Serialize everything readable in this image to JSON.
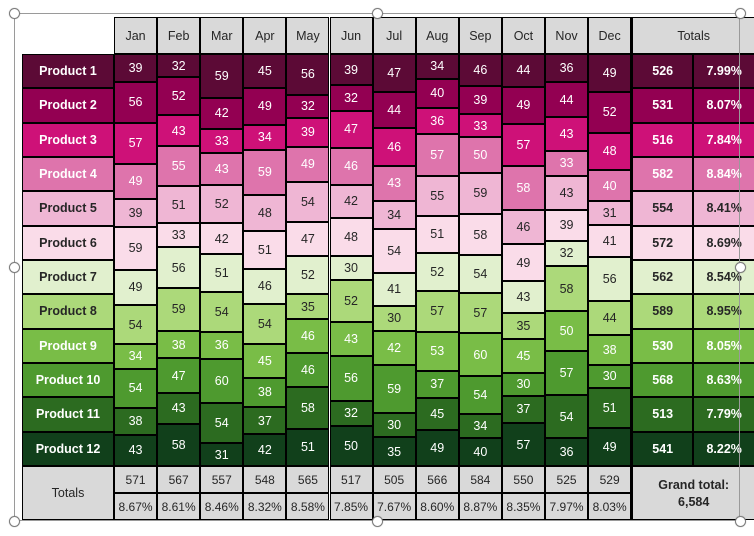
{
  "chart_data": {
    "type": "heatmap",
    "title": "",
    "xlabel": "",
    "ylabel": "",
    "grid": true,
    "legend": "none",
    "note": "Proportional-height heat map matrix: cell height within each month column is proportional to its value; row color encodes product rank (magenta-to-green diverging scale).",
    "categories": [
      "Jan",
      "Feb",
      "Mar",
      "Apr",
      "May",
      "Jun",
      "Jul",
      "Aug",
      "Sep",
      "Oct",
      "Nov",
      "Dec"
    ],
    "row_labels": [
      "Product 1",
      "Product 2",
      "Product 3",
      "Product 4",
      "Product 5",
      "Product 6",
      "Product 7",
      "Product 8",
      "Product 9",
      "Product 10",
      "Product 11",
      "Product 12"
    ],
    "series": [
      {
        "name": "Product 1",
        "values": [
          39,
          32,
          59,
          45,
          56,
          39,
          47,
          34,
          46,
          44,
          36,
          49
        ]
      },
      {
        "name": "Product 2",
        "values": [
          56,
          52,
          42,
          49,
          32,
          32,
          44,
          40,
          39,
          49,
          44,
          52
        ]
      },
      {
        "name": "Product 3",
        "values": [
          57,
          43,
          33,
          34,
          39,
          47,
          46,
          36,
          33,
          57,
          43,
          48
        ]
      },
      {
        "name": "Product 4",
        "values": [
          49,
          55,
          43,
          59,
          49,
          46,
          43,
          57,
          50,
          58,
          33,
          40
        ]
      },
      {
        "name": "Product 5",
        "values": [
          39,
          51,
          52,
          48,
          54,
          42,
          34,
          55,
          59,
          46,
          43,
          31
        ]
      },
      {
        "name": "Product 6",
        "values": [
          59,
          33,
          42,
          51,
          47,
          48,
          54,
          51,
          58,
          49,
          39,
          41
        ]
      },
      {
        "name": "Product 7",
        "values": [
          49,
          56,
          51,
          46,
          52,
          30,
          41,
          52,
          54,
          43,
          32,
          56
        ]
      },
      {
        "name": "Product 8",
        "values": [
          54,
          59,
          54,
          54,
          35,
          52,
          30,
          57,
          57,
          35,
          58,
          44
        ]
      },
      {
        "name": "Product 9",
        "values": [
          34,
          38,
          36,
          45,
          46,
          43,
          42,
          53,
          60,
          45,
          50,
          38
        ]
      },
      {
        "name": "Product 10",
        "values": [
          54,
          47,
          60,
          38,
          46,
          56,
          59,
          37,
          54,
          30,
          57,
          30
        ]
      },
      {
        "name": "Product 11",
        "values": [
          38,
          43,
          54,
          37,
          58,
          32,
          30,
          45,
          34,
          37,
          54,
          51
        ]
      },
      {
        "name": "Product 12",
        "values": [
          43,
          58,
          31,
          42,
          51,
          50,
          35,
          49,
          40,
          57,
          36,
          49
        ]
      }
    ],
    "row_totals": [
      526,
      531,
      516,
      582,
      554,
      572,
      562,
      589,
      530,
      568,
      513,
      541
    ],
    "row_percents": [
      "7.99%",
      "8.07%",
      "7.84%",
      "8.84%",
      "8.41%",
      "8.69%",
      "8.54%",
      "8.95%",
      "8.05%",
      "8.63%",
      "7.79%",
      "8.22%"
    ],
    "column_totals": [
      571,
      567,
      557,
      548,
      565,
      517,
      505,
      566,
      584,
      550,
      525,
      529
    ],
    "column_percents": [
      "8.67%",
      "8.61%",
      "8.46%",
      "8.32%",
      "8.58%",
      "7.85%",
      "7.67%",
      "8.60%",
      "8.87%",
      "8.35%",
      "7.97%",
      "8.03%"
    ],
    "grand_total": "6,584",
    "row_colors": [
      "#5C0A36",
      "#930052",
      "#CE1178",
      "#DE74AC",
      "#EFB6D4",
      "#FADCE9",
      "#E1F0CE",
      "#ACD97A",
      "#79BD47",
      "#4E9A2F",
      "#2C6B20",
      "#11401B"
    ],
    "header_fill": "#D9D9D9",
    "border_color": "#000000"
  },
  "header": {
    "months": [
      "Jan",
      "Feb",
      "Mar",
      "Apr",
      "May",
      "Jun",
      "Jul",
      "Aug",
      "Sep",
      "Oct",
      "Nov",
      "Dec"
    ],
    "totals_label": "Totals",
    "corner_label": ""
  },
  "footer": {
    "totals_label": "Totals",
    "grand_total_label": "Grand total:",
    "grand_total_value": "6,584"
  },
  "selection": {
    "handles": [
      "top-left",
      "top-center",
      "top-right",
      "middle-left",
      "middle-right",
      "bottom-left",
      "bottom-center",
      "bottom-right"
    ]
  }
}
